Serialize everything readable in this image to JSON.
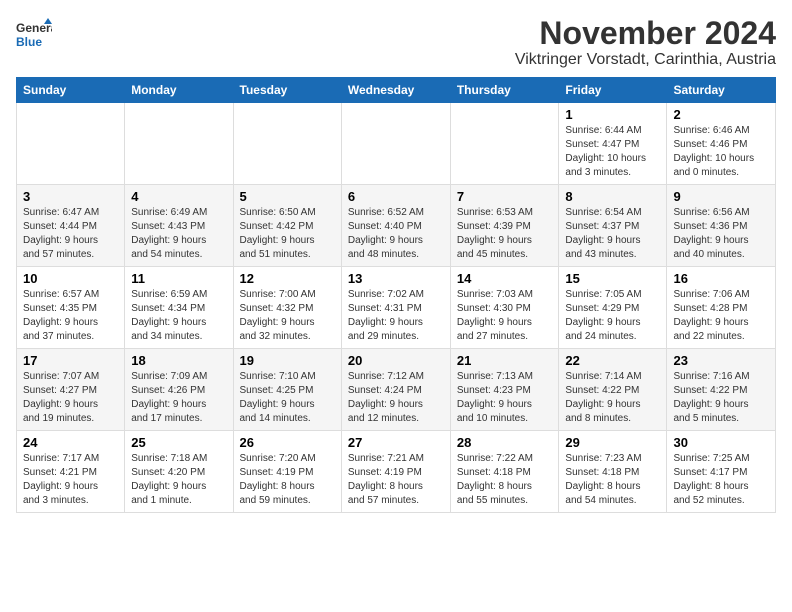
{
  "logo": {
    "general": "General",
    "blue": "Blue"
  },
  "title": "November 2024",
  "subtitle": "Viktringer Vorstadt, Carinthia, Austria",
  "headers": [
    "Sunday",
    "Monday",
    "Tuesday",
    "Wednesday",
    "Thursday",
    "Friday",
    "Saturday"
  ],
  "weeks": [
    [
      {
        "day": "",
        "info": ""
      },
      {
        "day": "",
        "info": ""
      },
      {
        "day": "",
        "info": ""
      },
      {
        "day": "",
        "info": ""
      },
      {
        "day": "",
        "info": ""
      },
      {
        "day": "1",
        "info": "Sunrise: 6:44 AM\nSunset: 4:47 PM\nDaylight: 10 hours\nand 3 minutes."
      },
      {
        "day": "2",
        "info": "Sunrise: 6:46 AM\nSunset: 4:46 PM\nDaylight: 10 hours\nand 0 minutes."
      }
    ],
    [
      {
        "day": "3",
        "info": "Sunrise: 6:47 AM\nSunset: 4:44 PM\nDaylight: 9 hours\nand 57 minutes."
      },
      {
        "day": "4",
        "info": "Sunrise: 6:49 AM\nSunset: 4:43 PM\nDaylight: 9 hours\nand 54 minutes."
      },
      {
        "day": "5",
        "info": "Sunrise: 6:50 AM\nSunset: 4:42 PM\nDaylight: 9 hours\nand 51 minutes."
      },
      {
        "day": "6",
        "info": "Sunrise: 6:52 AM\nSunset: 4:40 PM\nDaylight: 9 hours\nand 48 minutes."
      },
      {
        "day": "7",
        "info": "Sunrise: 6:53 AM\nSunset: 4:39 PM\nDaylight: 9 hours\nand 45 minutes."
      },
      {
        "day": "8",
        "info": "Sunrise: 6:54 AM\nSunset: 4:37 PM\nDaylight: 9 hours\nand 43 minutes."
      },
      {
        "day": "9",
        "info": "Sunrise: 6:56 AM\nSunset: 4:36 PM\nDaylight: 9 hours\nand 40 minutes."
      }
    ],
    [
      {
        "day": "10",
        "info": "Sunrise: 6:57 AM\nSunset: 4:35 PM\nDaylight: 9 hours\nand 37 minutes."
      },
      {
        "day": "11",
        "info": "Sunrise: 6:59 AM\nSunset: 4:34 PM\nDaylight: 9 hours\nand 34 minutes."
      },
      {
        "day": "12",
        "info": "Sunrise: 7:00 AM\nSunset: 4:32 PM\nDaylight: 9 hours\nand 32 minutes."
      },
      {
        "day": "13",
        "info": "Sunrise: 7:02 AM\nSunset: 4:31 PM\nDaylight: 9 hours\nand 29 minutes."
      },
      {
        "day": "14",
        "info": "Sunrise: 7:03 AM\nSunset: 4:30 PM\nDaylight: 9 hours\nand 27 minutes."
      },
      {
        "day": "15",
        "info": "Sunrise: 7:05 AM\nSunset: 4:29 PM\nDaylight: 9 hours\nand 24 minutes."
      },
      {
        "day": "16",
        "info": "Sunrise: 7:06 AM\nSunset: 4:28 PM\nDaylight: 9 hours\nand 22 minutes."
      }
    ],
    [
      {
        "day": "17",
        "info": "Sunrise: 7:07 AM\nSunset: 4:27 PM\nDaylight: 9 hours\nand 19 minutes."
      },
      {
        "day": "18",
        "info": "Sunrise: 7:09 AM\nSunset: 4:26 PM\nDaylight: 9 hours\nand 17 minutes."
      },
      {
        "day": "19",
        "info": "Sunrise: 7:10 AM\nSunset: 4:25 PM\nDaylight: 9 hours\nand 14 minutes."
      },
      {
        "day": "20",
        "info": "Sunrise: 7:12 AM\nSunset: 4:24 PM\nDaylight: 9 hours\nand 12 minutes."
      },
      {
        "day": "21",
        "info": "Sunrise: 7:13 AM\nSunset: 4:23 PM\nDaylight: 9 hours\nand 10 minutes."
      },
      {
        "day": "22",
        "info": "Sunrise: 7:14 AM\nSunset: 4:22 PM\nDaylight: 9 hours\nand 8 minutes."
      },
      {
        "day": "23",
        "info": "Sunrise: 7:16 AM\nSunset: 4:22 PM\nDaylight: 9 hours\nand 5 minutes."
      }
    ],
    [
      {
        "day": "24",
        "info": "Sunrise: 7:17 AM\nSunset: 4:21 PM\nDaylight: 9 hours\nand 3 minutes."
      },
      {
        "day": "25",
        "info": "Sunrise: 7:18 AM\nSunset: 4:20 PM\nDaylight: 9 hours\nand 1 minute."
      },
      {
        "day": "26",
        "info": "Sunrise: 7:20 AM\nSunset: 4:19 PM\nDaylight: 8 hours\nand 59 minutes."
      },
      {
        "day": "27",
        "info": "Sunrise: 7:21 AM\nSunset: 4:19 PM\nDaylight: 8 hours\nand 57 minutes."
      },
      {
        "day": "28",
        "info": "Sunrise: 7:22 AM\nSunset: 4:18 PM\nDaylight: 8 hours\nand 55 minutes."
      },
      {
        "day": "29",
        "info": "Sunrise: 7:23 AM\nSunset: 4:18 PM\nDaylight: 8 hours\nand 54 minutes."
      },
      {
        "day": "30",
        "info": "Sunrise: 7:25 AM\nSunset: 4:17 PM\nDaylight: 8 hours\nand 52 minutes."
      }
    ]
  ]
}
